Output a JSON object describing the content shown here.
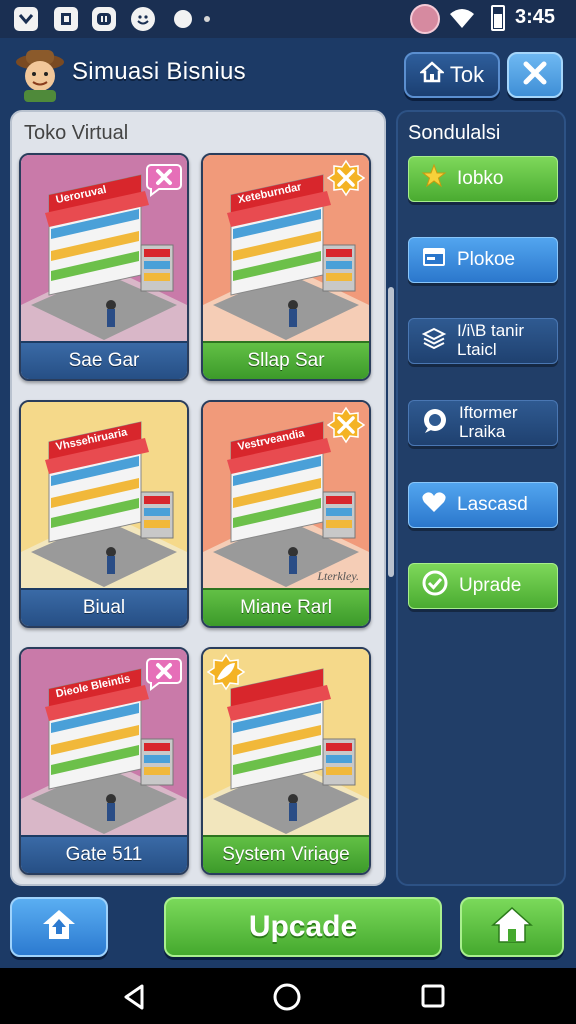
{
  "status_bar": {
    "time": "3:45",
    "icons": [
      "check-box-icon",
      "media-icon",
      "chat-icon",
      "smiley-icon",
      "dot-icon",
      "avatar-icon",
      "wifi-icon",
      "battery-icon"
    ]
  },
  "header": {
    "title": "Simuasi Bisnius",
    "tok_button": "Tok",
    "icons": [
      "mascot-icon",
      "home-icon",
      "close-icon"
    ]
  },
  "shop": {
    "title": "Toko Virtual",
    "watermark": "Lterkley.",
    "cards": [
      {
        "label": "Sae Gar",
        "sign": "Ueroruval",
        "style": "blue",
        "badge": "close-badge"
      },
      {
        "label": "Sllap Sar",
        "sign": "Xeteburndar",
        "style": "green",
        "badge": "star-badge"
      },
      {
        "label": "Biual",
        "sign": "Vhssehiruaria",
        "style": "blue",
        "badge": ""
      },
      {
        "label": "Miane Rarl",
        "sign": "Vestrveandia",
        "style": "green",
        "badge": "star-badge"
      },
      {
        "label": "Gate 511",
        "sign": "Dieole Bleintis",
        "style": "blue",
        "badge": "close-badge"
      },
      {
        "label": "System Viriage",
        "sign": "",
        "style": "green",
        "badge": "leaf-badge"
      }
    ]
  },
  "sidebar": {
    "title": "Sondulalsi",
    "buttons": [
      {
        "label": "Iobko",
        "icon": "star-icon",
        "style": "green"
      },
      {
        "label": "Plokoe",
        "icon": "window-icon",
        "style": "blue"
      },
      {
        "label": "I/i\\B tanir Ltaicl",
        "icon": "layers-icon",
        "style": "navy"
      },
      {
        "label": "Iftormer Lraika",
        "icon": "chat-bubble-icon",
        "style": "navy"
      },
      {
        "label": "Lascasd",
        "icon": "heart-icon",
        "style": "blue"
      },
      {
        "label": "Uprade",
        "icon": "check-circle-icon",
        "style": "green"
      }
    ]
  },
  "bottom_bar": {
    "main_button": "Upcade",
    "icons": [
      "upload-home-icon",
      "home-icon"
    ]
  },
  "colors": {
    "background": "#1c3a66",
    "accent_green": "#4aab31",
    "accent_blue": "#2b77cc",
    "awning_red": "#d8262c"
  }
}
